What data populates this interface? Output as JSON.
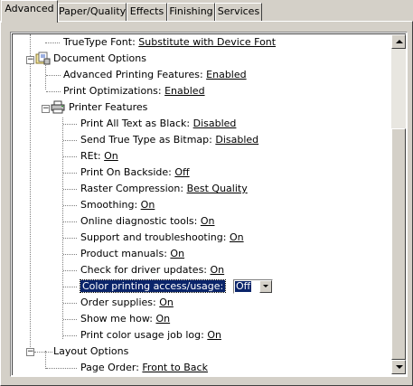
{
  "tabs": [
    {
      "label": "Advanced",
      "active": true
    },
    {
      "label": "Paper/Quality",
      "active": false
    },
    {
      "label": "Effects",
      "active": false
    },
    {
      "label": "Finishing",
      "active": false
    },
    {
      "label": "Services",
      "active": false
    }
  ],
  "tree": {
    "truetype_font": {
      "label": "TrueType Font:",
      "value": "Substitute with Device Font"
    },
    "document_options": {
      "label": "Document Options",
      "icon": "document-options-icon",
      "advanced_printing": {
        "label": "Advanced Printing Features:",
        "value": "Enabled"
      },
      "print_optimizations": {
        "label": "Print Optimizations:",
        "value": "Enabled"
      }
    },
    "printer_features": {
      "label": "Printer Features",
      "icon": "printer-features-icon",
      "items": [
        {
          "label": "Print All Text as Black:",
          "value": "Disabled"
        },
        {
          "label": "Send True Type as Bitmap:",
          "value": "Disabled"
        },
        {
          "label": "REt:",
          "value": "On"
        },
        {
          "label": "Print On Backside:",
          "value": "Off"
        },
        {
          "label": "Raster Compression:",
          "value": "Best Quality"
        },
        {
          "label": "Smoothing:",
          "value": "On"
        },
        {
          "label": "Online diagnostic tools:",
          "value": "On"
        },
        {
          "label": "Support and troubleshooting:",
          "value": "On"
        },
        {
          "label": "Product manuals:",
          "value": "On"
        },
        {
          "label": "Check for driver updates:",
          "value": "On"
        },
        {
          "label": "Color printing access/usage:",
          "value": "Off",
          "selected": true
        },
        {
          "label": "Order supplies:",
          "value": "On"
        },
        {
          "label": "Show me how:",
          "value": "On"
        },
        {
          "label": "Print color usage job log:",
          "value": "On"
        }
      ]
    },
    "layout_options": {
      "label": "Layout Options",
      "page_order": {
        "label": "Page Order:",
        "value": "Front to Back"
      }
    }
  },
  "colors": {
    "selection": "#0a246a",
    "face": "#d4d0c8"
  }
}
